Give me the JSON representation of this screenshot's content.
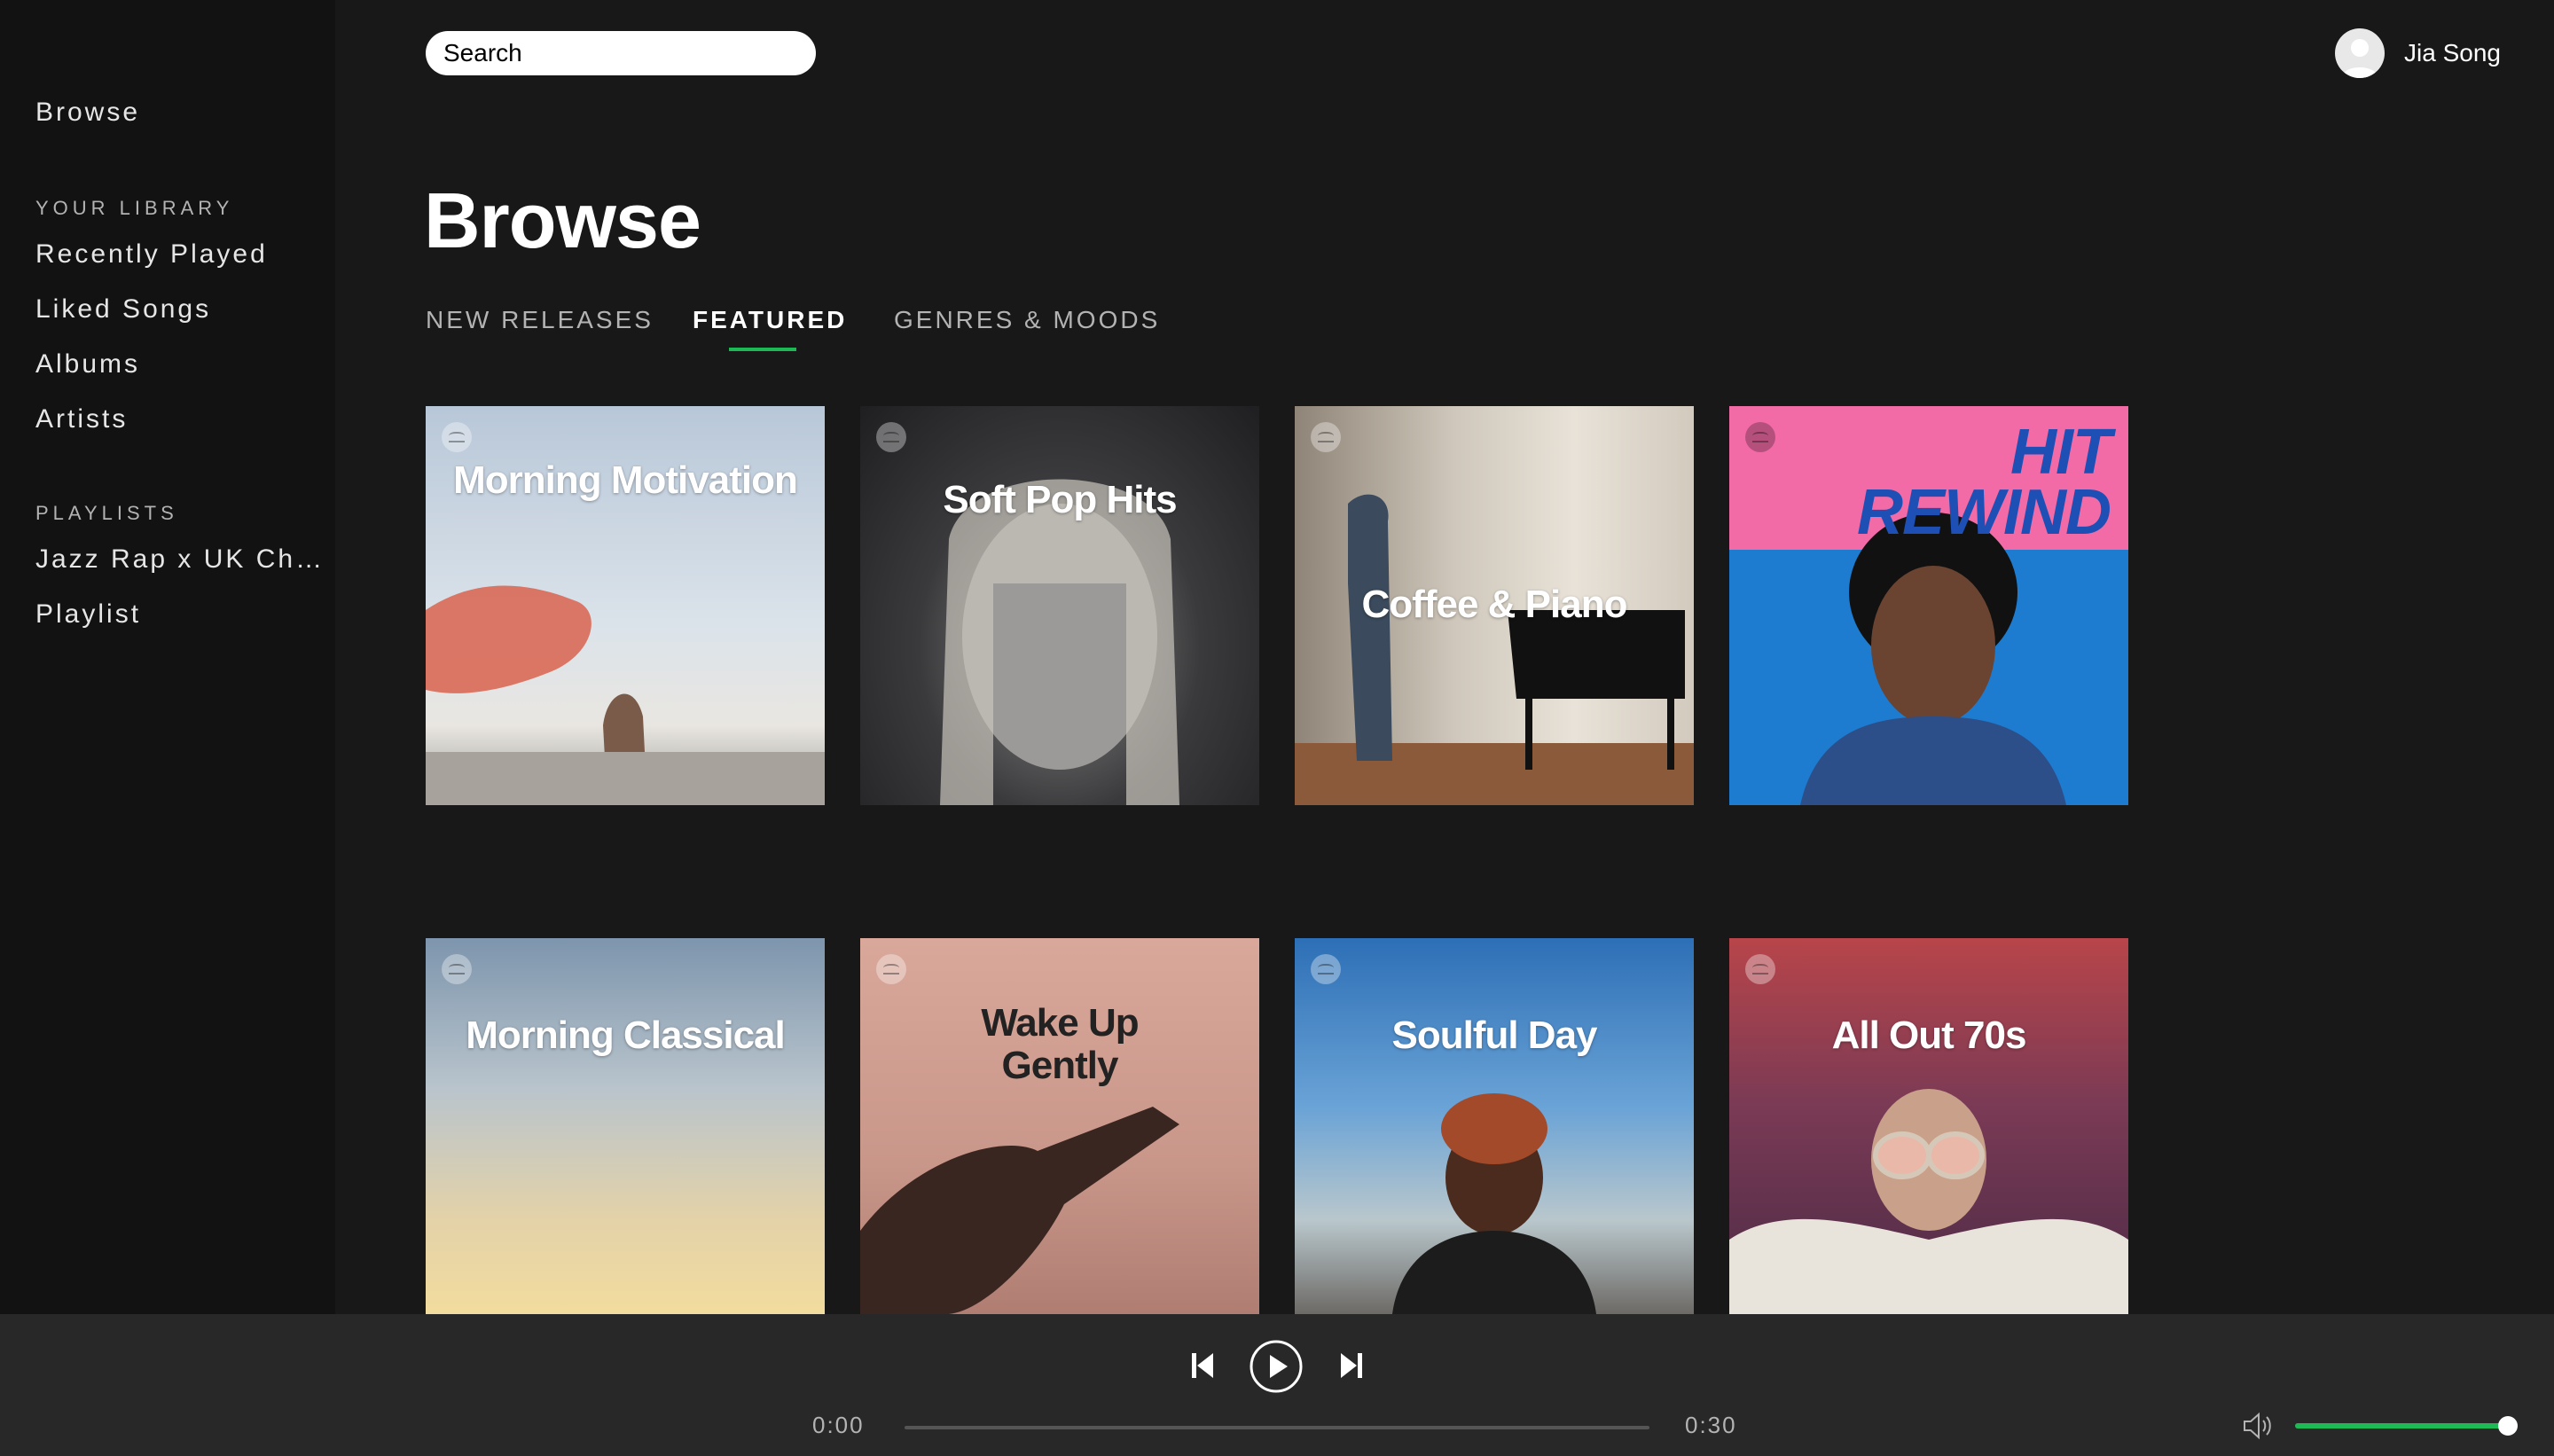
{
  "sidebar": {
    "browse": "Browse",
    "library_heading": "YOUR LIBRARY",
    "library_items": [
      "Recently Played",
      "Liked Songs",
      "Albums",
      "Artists"
    ],
    "playlists_heading": "PLAYLISTS",
    "playlists": [
      "Jazz Rap x UK Ch…",
      "Playlist"
    ]
  },
  "search": {
    "placeholder": "Search"
  },
  "user": {
    "name": "Jia Song"
  },
  "main": {
    "title": "Browse",
    "tabs": [
      {
        "label": "NEW RELEASES",
        "active": false
      },
      {
        "label": "FEATURED",
        "active": true
      },
      {
        "label": "GENRES & MOODS",
        "active": false
      }
    ],
    "playlists": [
      {
        "title": "Morning Motivation"
      },
      {
        "title": "Soft Pop Hits"
      },
      {
        "title": "Coffee & Piano"
      },
      {
        "title": "HIT REWIND"
      },
      {
        "title": "Morning Classical"
      },
      {
        "title": "Wake Up Gently"
      },
      {
        "title": "Soulful Day"
      },
      {
        "title": "All Out 70s"
      }
    ]
  },
  "player": {
    "elapsed": "0:00",
    "duration": "0:30",
    "progress": 0.0,
    "volume": 1.0
  },
  "colors": {
    "accent": "#1db954",
    "background": "#181818",
    "sidebar": "#121212",
    "player_bar": "#282828"
  }
}
